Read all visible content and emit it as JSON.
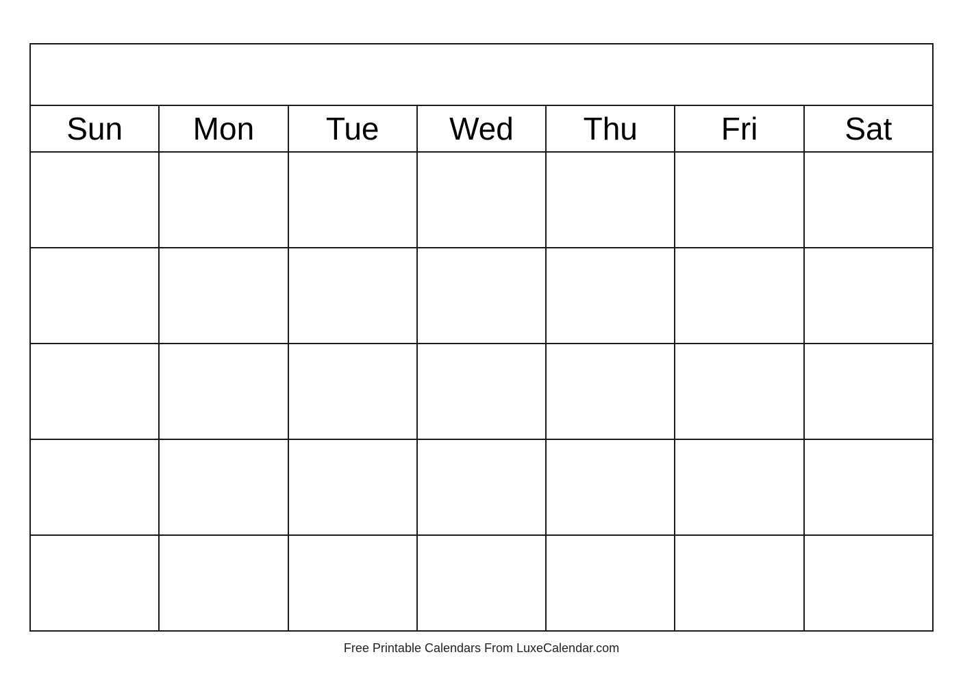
{
  "calendar": {
    "days": [
      "Sun",
      "Mon",
      "Tue",
      "Wed",
      "Thu",
      "Fri",
      "Sat"
    ],
    "rows": 5
  },
  "footer": {
    "text": "Free Printable Calendars From LuxeCalendar.com"
  }
}
